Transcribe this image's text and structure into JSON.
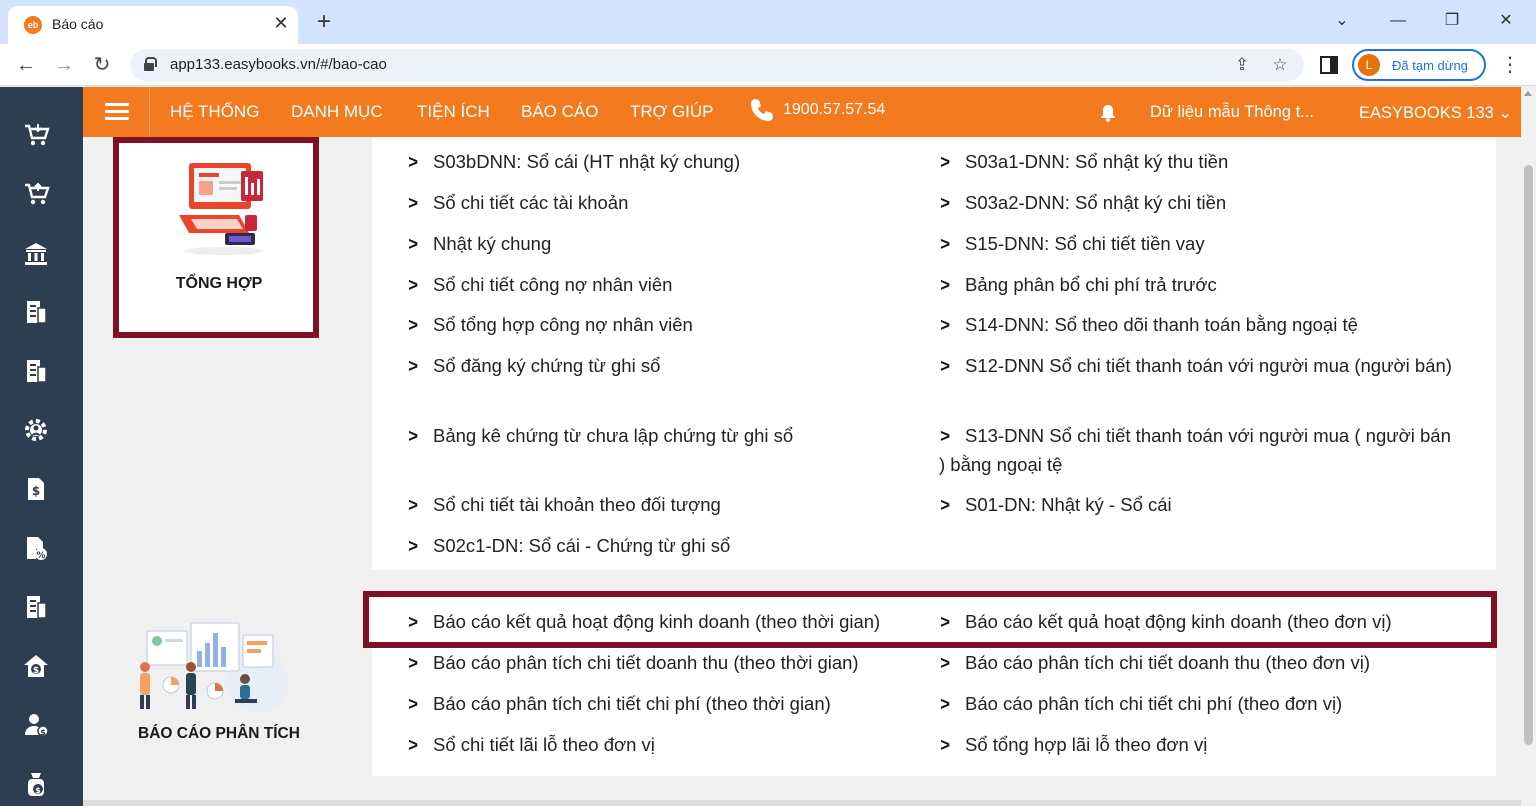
{
  "browser": {
    "tab_title": "Báo cáo",
    "favicon_text": "eb",
    "url": "app133.easybooks.vn/#/bao-cao",
    "profile_initial": "L",
    "profile_label": "Đã tạm dừng"
  },
  "topnav": {
    "items": [
      "HỆ THỐNG",
      "DANH MỤC",
      "TIỆN ÍCH",
      "BÁO CÁO",
      "TRỢ GIÚP"
    ],
    "phone": "1900.57.57.54",
    "dataset": "Dữ liệu mẫu Thông t...",
    "company": "EASYBOOKS 133 ⌄"
  },
  "sidebar": {
    "icons": [
      "cart-download-icon",
      "cart-upload-icon",
      "bank-icon",
      "invoice-icon",
      "invoice-2-icon",
      "gear-settings-icon",
      "tax-document-icon",
      "document-percent-icon",
      "building-report-icon",
      "home-money-icon",
      "user-money-icon",
      "money-bag-icon"
    ]
  },
  "categories": {
    "summary": {
      "label": "TỔNG HỢP"
    },
    "analysis": {
      "label": "BÁO CÁO PHÂN TÍCH"
    }
  },
  "summary_reports": {
    "left": [
      "S03bDNN: Sổ cái (HT nhật ký chung)",
      "Sổ chi tiết các tài khoản",
      "Nhật ký chung",
      "Sổ chi tiết công nợ nhân viên",
      "Sổ tổng hợp công nợ nhân viên",
      "Sổ đăng ký chứng từ ghi sổ",
      "Bảng kê chứng từ chưa lập chứng từ ghi sổ",
      "Sổ chi tiết tài khoản theo đối tượng",
      "S02c1-DN: Sổ cái - Chứng từ ghi sổ"
    ],
    "right": [
      "S03a1-DNN: Sổ nhật ký thu tiền",
      "S03a2-DNN: Sổ nhật ký chi tiền",
      "S15-DNN: Sổ chi tiết tiền vay",
      "Bảng phân bổ chi phí trả trước",
      "S14-DNN: Sổ theo dõi thanh toán bằng ngoại tệ",
      "S12-DNN Sổ chi tiết thanh toán với người mua (người bán)",
      "S13-DNN Sổ chi tiết thanh toán với người mua ( người bán ) bằng ngoại tệ",
      "S01-DN: Nhật ký - Sổ cái"
    ]
  },
  "analysis_reports": {
    "left": [
      "Báo cáo kết quả hoạt động kinh doanh (theo thời gian)",
      "Báo cáo phân tích chi tiết doanh thu (theo thời gian)",
      "Báo cáo phân tích chi tiết chi phí (theo thời gian)",
      "Sổ chi tiết lãi lỗ theo đơn vị"
    ],
    "right": [
      "Báo cáo kết quả hoạt động kinh doanh (theo đơn vị)",
      "Báo cáo phân tích chi tiết doanh thu (theo đơn vị)",
      "Báo cáo phân tích chi tiết chi phí (theo đơn vị)",
      "Sổ tổng hợp lãi lỗ theo đơn vị"
    ]
  },
  "colors": {
    "orange": "#f47a20",
    "sidebar": "#2d3e50",
    "highlight": "#7d1128"
  }
}
